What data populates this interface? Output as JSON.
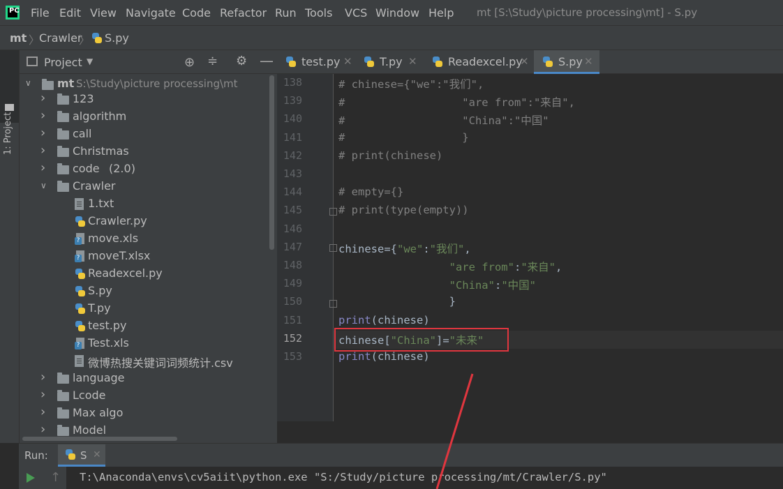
{
  "menubar": {
    "items": [
      "File",
      "Edit",
      "View",
      "Navigate",
      "Code",
      "Refactor",
      "Run",
      "Tools",
      "VCS",
      "Window",
      "Help"
    ],
    "window_title": "mt [S:\\Study\\picture processing\\mt] - S.py"
  },
  "breadcrumb": {
    "items": [
      "mt",
      "Crawler",
      "S.py"
    ]
  },
  "left_strip": {
    "project_tab": "1: Project"
  },
  "project_panel": {
    "title": "Project",
    "root_name": "mt",
    "root_path": "S:\\Study\\picture processing\\mt",
    "tree": [
      {
        "label": "123",
        "type": "folder",
        "depth": 1,
        "expanded": false
      },
      {
        "label": "algorithm",
        "type": "folder",
        "depth": 1,
        "expanded": false
      },
      {
        "label": "call",
        "type": "folder",
        "depth": 1,
        "expanded": false
      },
      {
        "label": "Christmas",
        "type": "folder",
        "depth": 1,
        "expanded": false
      },
      {
        "label": "code",
        "extra": "(2.0)",
        "type": "folder",
        "depth": 1,
        "expanded": false
      },
      {
        "label": "Crawler",
        "type": "folder",
        "depth": 1,
        "expanded": true
      },
      {
        "label": "1.txt",
        "type": "text",
        "depth": 2
      },
      {
        "label": "Crawler.py",
        "type": "python",
        "depth": 2
      },
      {
        "label": "move.xls",
        "type": "excel",
        "depth": 2
      },
      {
        "label": "moveT.xlsx",
        "type": "excel",
        "depth": 2
      },
      {
        "label": "Readexcel.py",
        "type": "python",
        "depth": 2
      },
      {
        "label": "S.py",
        "type": "python",
        "depth": 2
      },
      {
        "label": "T.py",
        "type": "python",
        "depth": 2
      },
      {
        "label": "test.py",
        "type": "python",
        "depth": 2
      },
      {
        "label": "Test.xls",
        "type": "excel",
        "depth": 2
      },
      {
        "label": "微博热搜关键词词频统计.csv",
        "type": "text",
        "depth": 2
      },
      {
        "label": "language",
        "type": "folder",
        "depth": 1,
        "expanded": false
      },
      {
        "label": "Lcode",
        "type": "folder",
        "depth": 1,
        "expanded": false
      },
      {
        "label": "Max algo",
        "type": "folder",
        "depth": 1,
        "expanded": false
      },
      {
        "label": "Model",
        "type": "folder",
        "depth": 1,
        "expanded": false
      }
    ]
  },
  "editor_tabs": [
    {
      "label": "test.py",
      "active": false
    },
    {
      "label": "T.py",
      "active": false
    },
    {
      "label": "Readexcel.py",
      "active": false
    },
    {
      "label": "S.py",
      "active": true
    }
  ],
  "editor": {
    "current_line": 152,
    "lines": [
      {
        "n": "138",
        "text": "# chinese={\"we\":\"我们\","
      },
      {
        "n": "139",
        "text": "#                  \"are from\":\"来自\","
      },
      {
        "n": "140",
        "text": "#                  \"China\":\"中国\""
      },
      {
        "n": "141",
        "text": "#                  }"
      },
      {
        "n": "142",
        "text": "# print(chinese)"
      },
      {
        "n": "143",
        "text": ""
      },
      {
        "n": "144",
        "text": "# empty={}"
      },
      {
        "n": "145",
        "text": "# print(type(empty))"
      },
      {
        "n": "146",
        "text": ""
      },
      {
        "n": "147",
        "text": "chinese={\"we\":\"我们\","
      },
      {
        "n": "148",
        "text": "                 \"are from\":\"来自\","
      },
      {
        "n": "149",
        "text": "                 \"China\":\"中国\""
      },
      {
        "n": "150",
        "text": "                 }"
      },
      {
        "n": "151",
        "text": "print(chinese)"
      },
      {
        "n": "152",
        "text": "chinese[\"China\"]=\"未来\""
      },
      {
        "n": "153",
        "text": "print(chinese)"
      }
    ]
  },
  "run_panel": {
    "label": "Run:",
    "tab": "S",
    "command": "T:\\Anaconda\\envs\\cv5aiit\\python.exe \"S:/Study/picture processing/mt/Crawler/S.py\""
  },
  "colors": {
    "background": "#2b2b2b",
    "panel": "#3c3f41",
    "comment": "#808080",
    "string": "#6a8759",
    "builtin": "#8888c6",
    "highlight_box": "#e0363f",
    "accent": "#4a88c7"
  }
}
